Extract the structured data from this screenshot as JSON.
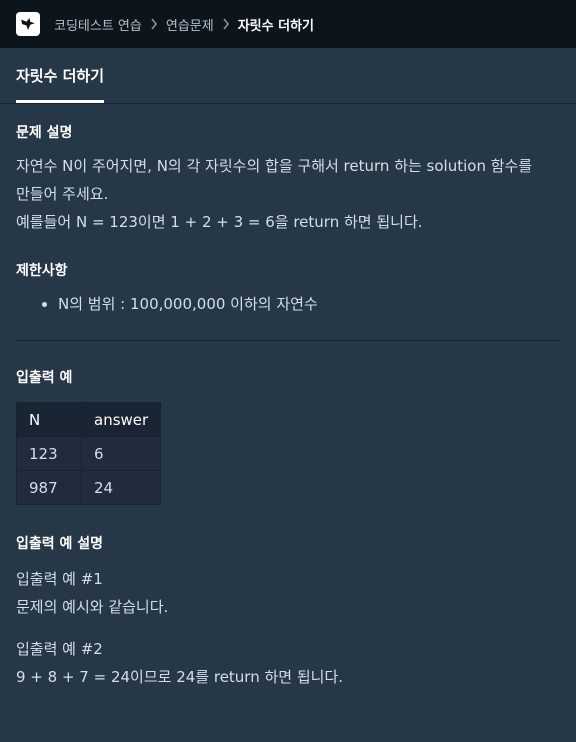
{
  "breadcrumb": {
    "items": [
      "코딩테스트 연습",
      "연습문제"
    ],
    "current": "자릿수 더하기"
  },
  "tab": {
    "label": "자릿수 더하기"
  },
  "problem": {
    "heading": "문제 설명",
    "line1": "자연수 N이 주어지면, N의 각 자릿수의 합을 구해서 return 하는 solution 함수를",
    "line2": "만들어 주세요.",
    "line3": "예를들어 N = 123이면 1 + 2 + 3 = 6을 return 하면 됩니다."
  },
  "limits": {
    "heading": "제한사항",
    "items": [
      "N의 범위 : 100,000,000 이하의 자연수"
    ]
  },
  "io": {
    "heading": "입출력 예",
    "columns": [
      "N",
      "answer"
    ],
    "rows": [
      [
        "123",
        "6"
      ],
      [
        "987",
        "24"
      ]
    ]
  },
  "explanation": {
    "heading": "입출력 예 설명",
    "ex1_title": "입출력 예 #1",
    "ex1_body": "문제의 예시와 같습니다.",
    "ex2_title": "입출력 예 #2",
    "ex2_body": "9 + 8 + 7 = 24이므로 24를 return 하면 됩니다."
  },
  "colors": {
    "topbar": "#0c151c",
    "background": "#263747",
    "text": "#d5dee7",
    "heading": "#ffffff"
  },
  "icons": {
    "logo": "bird-logo-icon",
    "separator": "chevron-right-icon"
  }
}
